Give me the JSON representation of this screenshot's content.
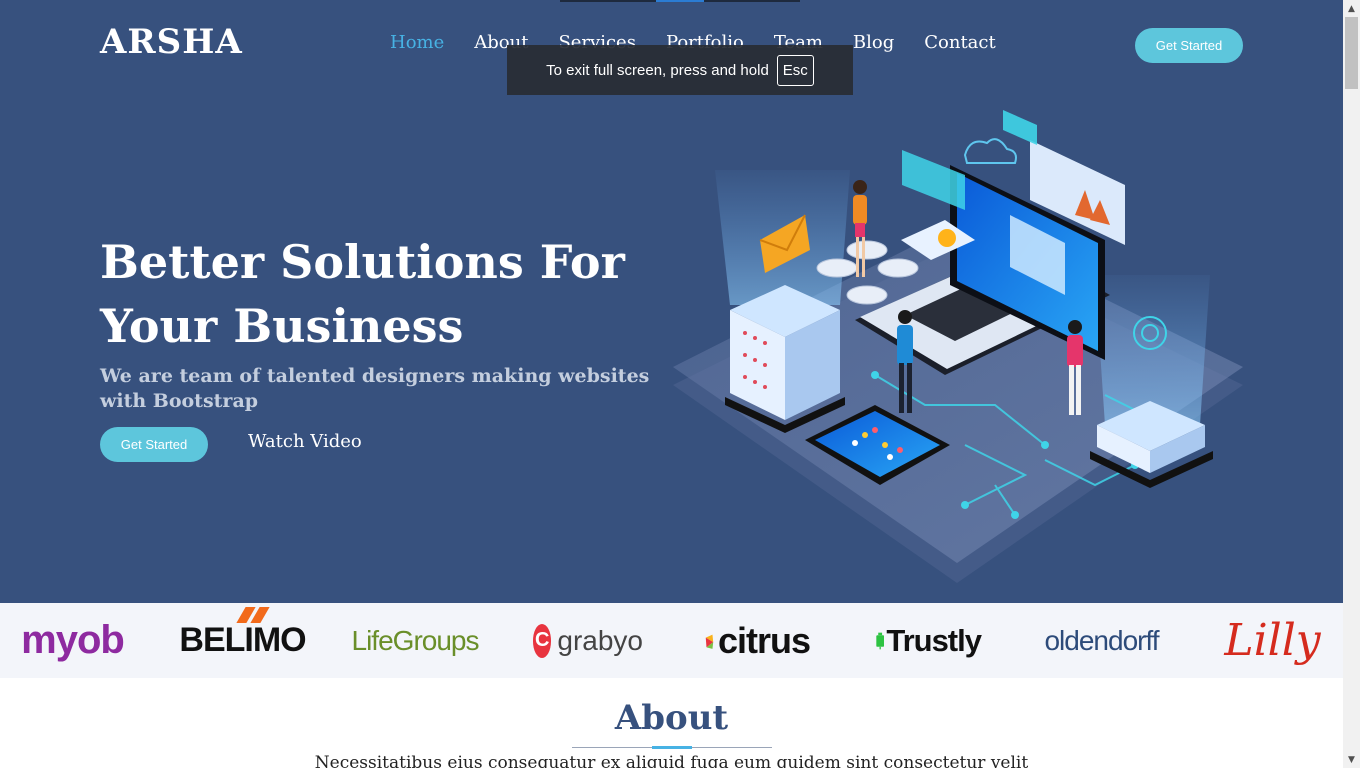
{
  "header": {
    "logo": "ARSHA",
    "nav": [
      "Home",
      "About",
      "Services",
      "Portfolio",
      "Team",
      "Blog",
      "Contact"
    ],
    "active": "Home",
    "cta": "Get Started"
  },
  "fullscreen_toast": {
    "message": "To exit full screen, press and hold",
    "key": "Esc"
  },
  "hero": {
    "title": "Better Solutions For Your Business",
    "subtitle": "We are team of talented designers making websites with Bootstrap",
    "cta": "Get Started",
    "video_link": "Watch Video"
  },
  "clients": [
    "myob",
    "BELIMO",
    "LifeGroups",
    "grabyo",
    "citrus",
    "Trustly",
    "oldendorff",
    "Lilly"
  ],
  "about": {
    "title": "About",
    "text": "Necessitatibus eius consequatur ex aliquid fuga eum quidem sint consectetur velit"
  },
  "colors": {
    "hero_bg": "#37517e",
    "accent": "#47b2e4",
    "button": "#5dc6dc"
  }
}
